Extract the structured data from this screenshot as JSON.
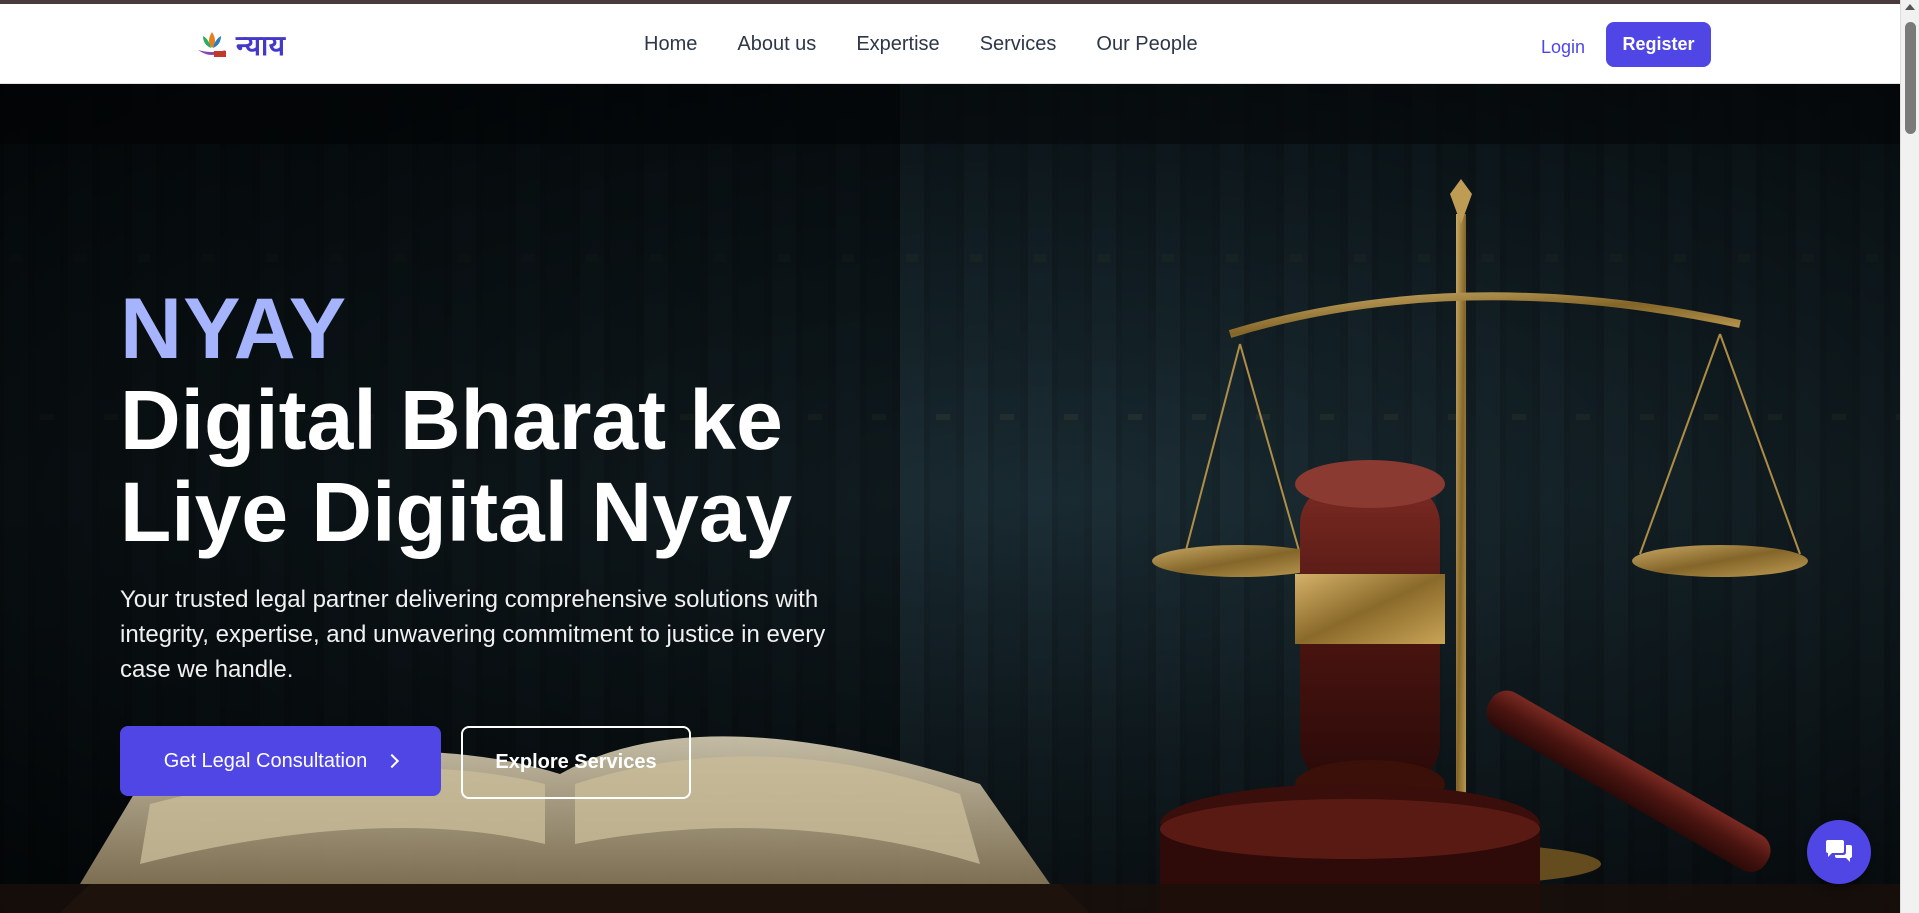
{
  "header": {
    "logo_text": "न्याय",
    "logo_icon": "lotus-scales-icon",
    "nav": [
      {
        "label": "Home"
      },
      {
        "label": "About us"
      },
      {
        "label": "Expertise"
      },
      {
        "label": "Services"
      },
      {
        "label": "Our People"
      }
    ],
    "login_label": "Login",
    "register_label": "Register"
  },
  "hero": {
    "brand": "NYAY",
    "title": "Digital Bharat ke Liye Digital Nyay",
    "description": "Your trusted legal partner delivering comprehensive solutions with integrity, expertise, and unwavering commitment to justice in every case we handle.",
    "primary_cta": "Get Legal Consultation",
    "secondary_cta": "Explore Services",
    "background": "law-books-scales-gavel-image"
  },
  "chat": {
    "icon": "chat-bubbles-icon"
  },
  "colors": {
    "accent": "#4f46e5",
    "brand_light": "#a5b4fc",
    "nav_text": "#2d3748"
  }
}
